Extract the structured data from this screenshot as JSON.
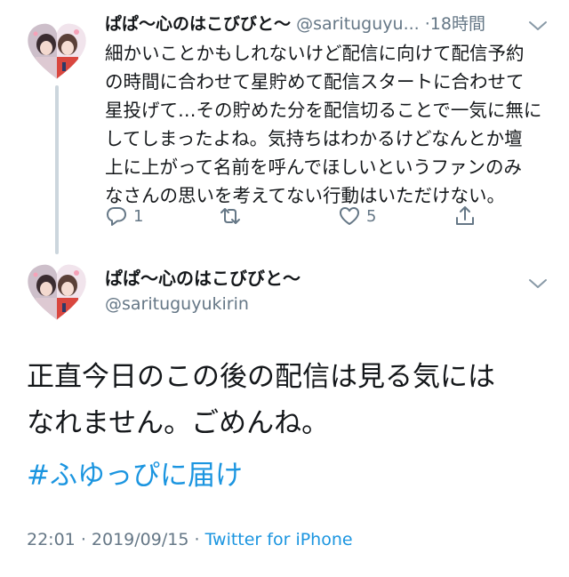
{
  "tweet1": {
    "display_name": "ぱぱ〜心のはこびびと〜",
    "handle": "@sarituguyu...",
    "separator": "·",
    "time": "18時間",
    "body_lines": [
      "細かいことかもしれないけど配信に向けて配信予約",
      "の時間に合わせて星貯めて配信スタートに合わせて",
      "星投げて…その貯めた分を配信切ることで一気に無に",
      "してしまったよね。気持ちはわかるけどなんとか壇",
      "上に上がって名前を呼んでほしいというファンのみ",
      "なさんの思いを考えてない行動はいただけない。"
    ],
    "reply_count": "1",
    "retweet_count": "",
    "like_count": "5"
  },
  "tweet2": {
    "display_name": "ぱぱ〜心のはこびびと〜",
    "handle": "@sarituguyukirin",
    "body_lines": [
      "正直今日のこの後の配信は見る気には",
      "なれません。ごめんね。"
    ],
    "hashtag": "#ふゆっぴに届け",
    "time": "22:01",
    "date": "2019/09/15",
    "meta_sep": "·",
    "source": "Twitter for iPhone"
  },
  "icons": {
    "avatar": "heart-photo-avatar-icon",
    "menu": "chevron-down-icon",
    "reply": "reply-icon",
    "retweet": "retweet-icon",
    "like": "heart-icon",
    "share": "share-icon"
  },
  "colors": {
    "text": "#14171a",
    "secondary": "#657786",
    "link": "#1b95e0",
    "thread_line": "#ccd6dd"
  }
}
